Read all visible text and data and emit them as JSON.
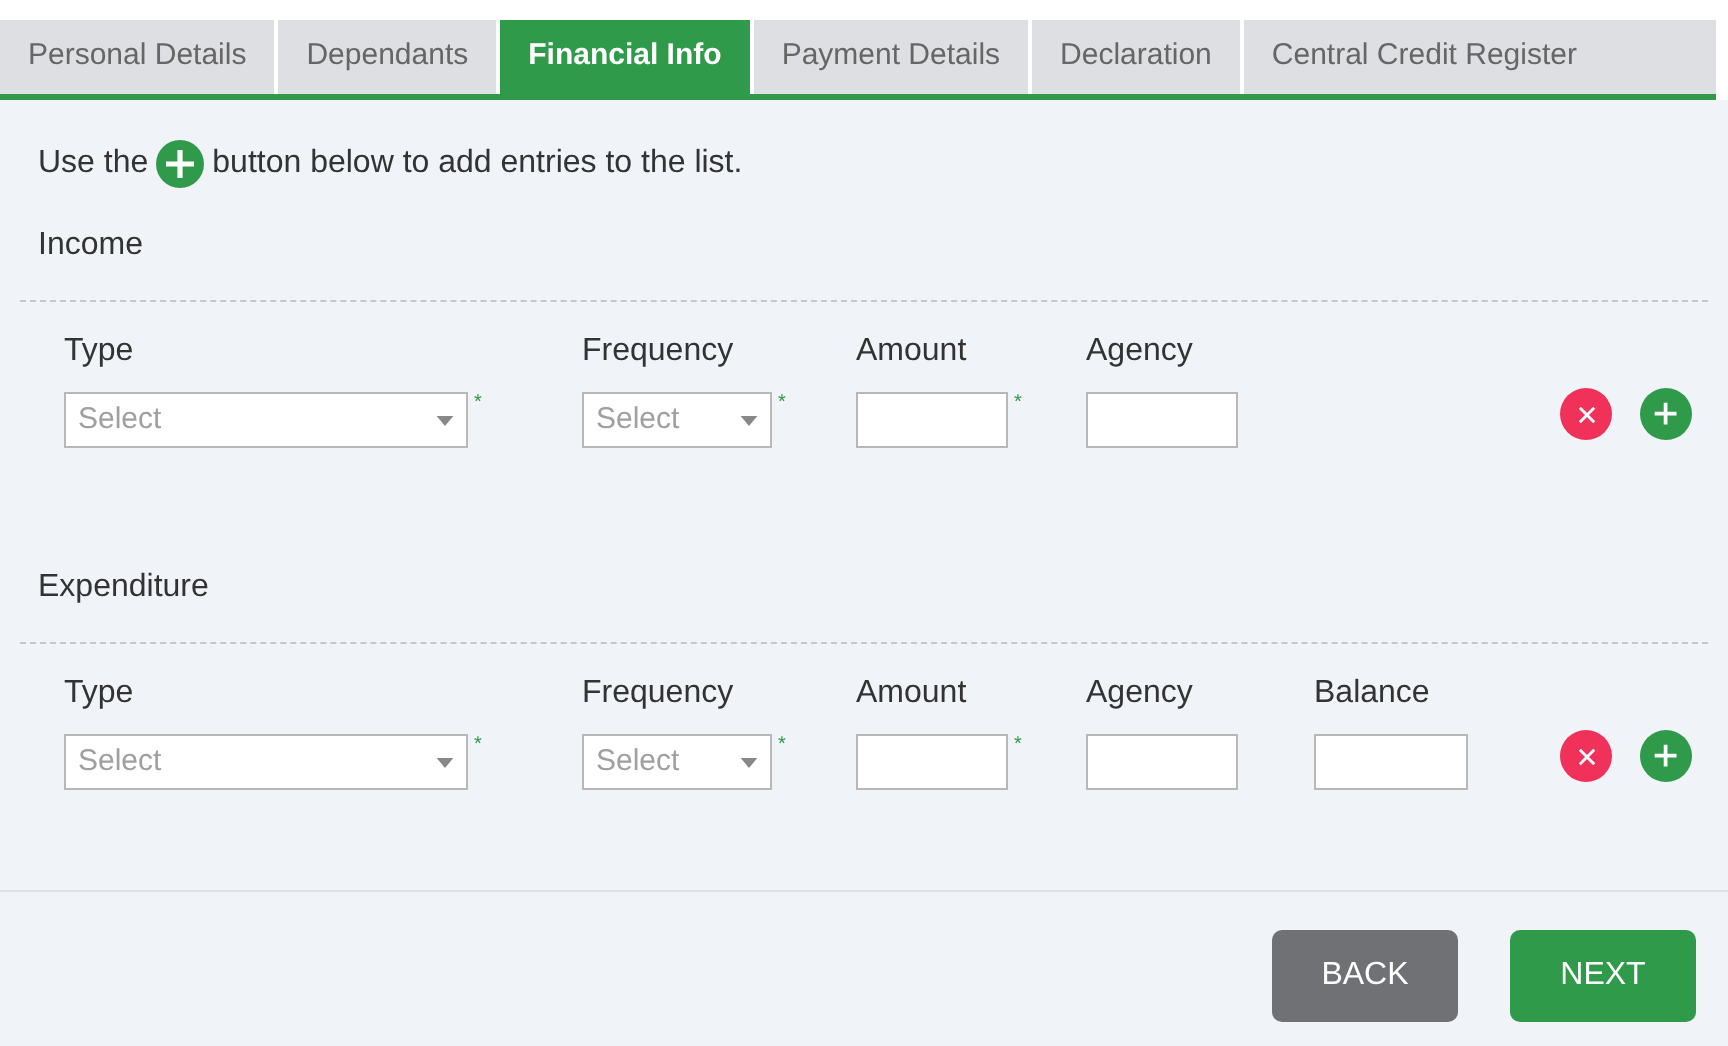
{
  "tabs": [
    {
      "label": "Personal Details",
      "selected": false
    },
    {
      "label": "Dependants",
      "selected": false
    },
    {
      "label": "Financial Info",
      "selected": true
    },
    {
      "label": "Payment Details",
      "selected": false
    },
    {
      "label": "Declaration",
      "selected": false
    },
    {
      "label": "Central Credit Register",
      "selected": false
    }
  ],
  "instruction": {
    "before": "Use the",
    "after": "button below to add entries to the list."
  },
  "sections": [
    {
      "title": "Income",
      "fields": [
        {
          "label": "Type",
          "kind": "select",
          "placeholder": "Select",
          "required_mark": "*"
        },
        {
          "label": "Frequency",
          "kind": "select",
          "placeholder": "Select",
          "required_mark": "*"
        },
        {
          "label": "Amount",
          "kind": "text",
          "required_mark": "*"
        },
        {
          "label": "Agency",
          "kind": "text"
        }
      ]
    },
    {
      "title": "Expenditure",
      "fields": [
        {
          "label": "Type",
          "kind": "select",
          "placeholder": "Select",
          "required_mark": "*"
        },
        {
          "label": "Frequency",
          "kind": "select",
          "placeholder": "Select",
          "required_mark": "*"
        },
        {
          "label": "Amount",
          "kind": "text",
          "required_mark": "*"
        },
        {
          "label": "Agency",
          "kind": "text"
        },
        {
          "label": "Balance",
          "kind": "text"
        }
      ]
    }
  ],
  "buttons": [
    {
      "label": "BACK",
      "kind": "secondary"
    },
    {
      "label": "NEXT",
      "kind": "primary"
    }
  ]
}
